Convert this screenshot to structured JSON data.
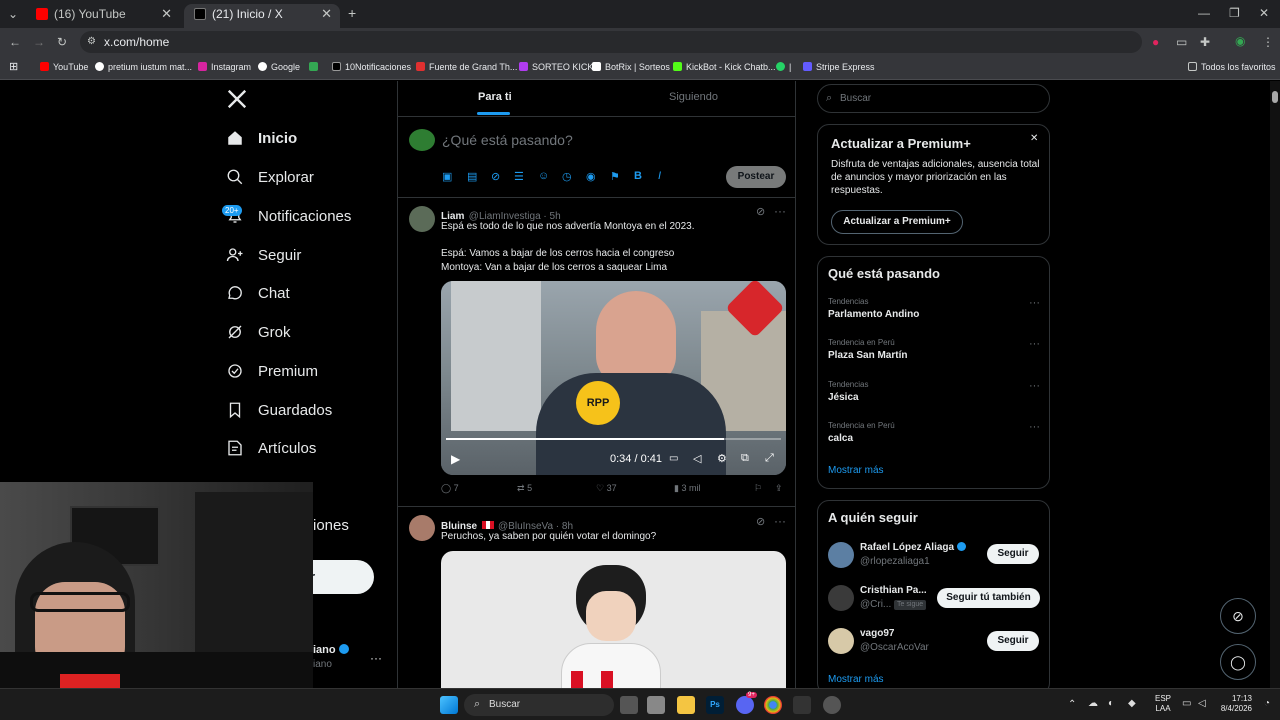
{
  "browser": {
    "tabs": [
      {
        "title": "(16) YouTube",
        "close": "✕"
      },
      {
        "title": "(21) Inicio / X",
        "close": "✕"
      }
    ],
    "new_tab": "+",
    "url": "x.com/home",
    "bookmarks": [
      "YouTube",
      "pretium iustum mat...",
      "Instagram",
      "Google",
      "10Notificaciones",
      "Fuente de Grand Th...",
      "SORTEO KICK",
      "BotRix | Sorteos",
      "KickBot - Kick Chatb...",
      "|",
      "Stripe Express"
    ],
    "all_bookmarks": "Todos los favoritos"
  },
  "nav": {
    "items": [
      "Inicio",
      "Explorar",
      "Notificaciones",
      "Seguir",
      "Chat",
      "Grok",
      "Premium",
      "Guardados",
      "Artículos"
    ],
    "partial_items": [
      "iones"
    ],
    "notif_badge": "20+",
    "post_btn_partial": "r",
    "profile_partial": "iano",
    "profile_handle_partial": "iano",
    "more": "···"
  },
  "feed": {
    "tabs": [
      "Para ti",
      "Siguiendo"
    ],
    "composer_placeholder": "¿Qué está pasando?",
    "post_button": "Postear",
    "posts": [
      {
        "name": "Liam",
        "handle": "@LiamInvestiga · 5h",
        "text1": "Espá es todo de lo que nos advertía Montoya en el 2023.",
        "text2": "Espá: Vamos a bajar de los cerros hacia el congreso",
        "text3": "Montoya: Van a bajar de los cerros a saquear Lima",
        "video_time": "0:34 / 0:41",
        "mic_label": "RPP",
        "replies": "7",
        "reposts": "5",
        "likes": "37",
        "views": "3 mil"
      },
      {
        "name": "Bluinse",
        "handle": "@BluInseVa · 8h",
        "text1": "Peruchos, ya saben por quién votar el domingo?"
      }
    ]
  },
  "sidebar": {
    "search_placeholder": "Buscar",
    "premium": {
      "title": "Actualizar a Premium+",
      "desc": "Disfruta de ventajas adicionales, ausencia total de anuncios y mayor priorización en las respuestas.",
      "button": "Actualizar a Premium+",
      "close": "✕"
    },
    "trends_title": "Qué está pasando",
    "trends": [
      {
        "cat": "Tendencias",
        "title": "Parlamento Andino"
      },
      {
        "cat": "Tendencia en Perú",
        "title": "Plaza San Martín"
      },
      {
        "cat": "Tendencias",
        "title": "Jésica"
      },
      {
        "cat": "Tendencia en Perú",
        "title": "calca"
      }
    ],
    "trend_more": "···",
    "show_more": "Mostrar más",
    "follow_title": "A quién seguir",
    "follows": [
      {
        "name": "Rafael López Aliaga",
        "handle": "@rlopezaliaga1",
        "button": "Seguir"
      },
      {
        "name": "Cristhian Pa...",
        "handle": "@Cri...",
        "tag": "Te sigue",
        "button": "Seguir tú también"
      },
      {
        "name": "vago97",
        "handle": "@OscarAcoVar",
        "button": "Seguir"
      }
    ],
    "follow_more": "Mostrar más"
  },
  "taskbar": {
    "search": "Buscar",
    "lang": "ESP",
    "lang2": "LAA",
    "time": "17:13",
    "date": "8/4/2026",
    "ps_label": "Ps",
    "badge": "9+"
  },
  "colors": {
    "accent": "#1d9bf0",
    "bg": "#000000",
    "border": "#2f3336"
  }
}
